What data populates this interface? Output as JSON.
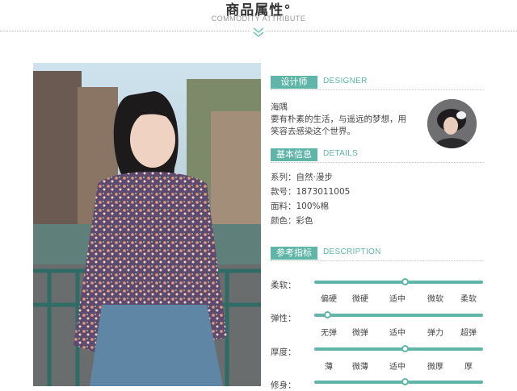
{
  "header": {
    "title": "商品属性°",
    "subtitle": "COMMODITY ATTRIBUTE"
  },
  "photo": {
    "description_icon": "model-photo"
  },
  "designer": {
    "tag": "设计师",
    "en": "DESIGNER",
    "name": "海隅",
    "bio_line1": "要有朴素的生活，与遥远的梦想，用",
    "bio_line2": "笑容去感染这个世界。"
  },
  "details": {
    "tag": "基本信息",
    "en": "DETAILS",
    "series": "系列：自然·漫步",
    "code": "款号：1873011005",
    "fabric": "面料：100%棉",
    "color": "颜色：彩色"
  },
  "description": {
    "tag": "参考指标",
    "en": "DESCRIPTION",
    "rows": [
      {
        "label": "柔软：",
        "ticks": [
          "偏硬",
          "微硬",
          "适中",
          "微软",
          "柔软"
        ],
        "level": 0.5
      },
      {
        "label": "弹性：",
        "ticks": [
          "无弹",
          "微弹",
          "适中",
          "弹力",
          "超弹"
        ],
        "level": 0.0
      },
      {
        "label": "厚度：",
        "ticks": [
          "薄",
          "微薄",
          "适中",
          "微厚",
          "厚"
        ],
        "level": 0.5
      },
      {
        "label": "修身：",
        "ticks": [],
        "level": 0.5
      }
    ]
  },
  "colors": {
    "accent": "#5fb5a8"
  }
}
